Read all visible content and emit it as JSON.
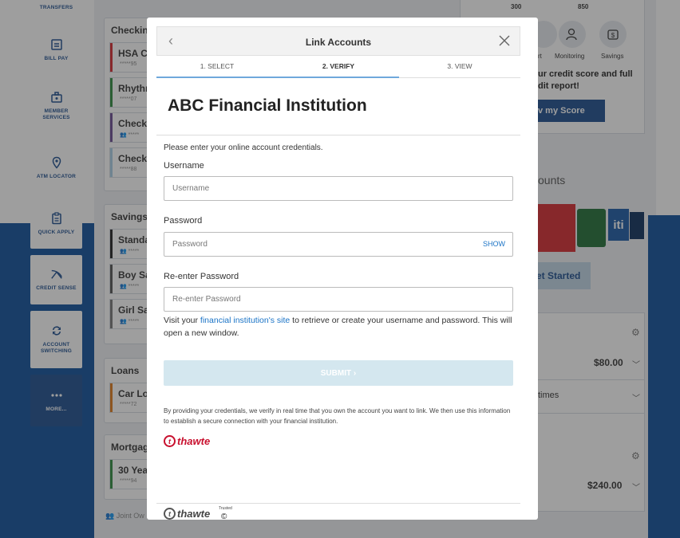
{
  "nav": {
    "transfers": "TRANSFERS",
    "bill_pay": "BILL PAY",
    "member_services": "MEMBER SERVICES",
    "atm_locator": "ATM LOCATOR",
    "quick_apply": "QUICK APPLY",
    "credit_sense": "CREDIT SENSE",
    "account_switching": "ACCOUNT SWITCHING",
    "more": "MORE..."
  },
  "accounts": {
    "checking_header": "Checkin",
    "checking_items": [
      {
        "name": "HSA C",
        "sub": "*****95",
        "color": "#d6282f"
      },
      {
        "name": "Rhythr",
        "sub": "*****07",
        "color": "#2e8b3e"
      },
      {
        "name": "Checki",
        "sub": "👥 *****",
        "color": "#6a4c93"
      },
      {
        "name": "Checki",
        "sub": "*****88",
        "color": "#a9cfe8"
      }
    ],
    "savings_header": "Savings",
    "savings_items": [
      {
        "name": "Standa",
        "sub": "👥 *****",
        "color": "#222222"
      },
      {
        "name": "Boy Sa",
        "sub": "👥 *****",
        "color": "#555555"
      },
      {
        "name": "Girl Sa",
        "sub": "👥 *****",
        "color": "#777777"
      }
    ],
    "loans_header": "Loans",
    "loans_items": [
      {
        "name": "Car Lo",
        "sub": "*****72",
        "color": "#e07b1a"
      }
    ],
    "mortgage_header": "Mortgag",
    "mortgage_items": [
      {
        "name": "30 Yea",
        "sub": "*****94",
        "color": "#2e8b3e"
      }
    ],
    "joint_label": "Joint Ow"
  },
  "credit": {
    "scale_low": "300",
    "scale_high": "850",
    "icon_labels": [
      "rt",
      "Monitoring",
      "Savings"
    ],
    "text": "ur credit score and full dit report!",
    "button": "v my Score"
  },
  "link_panel": {
    "title": "ounts",
    "logo_text": "iti",
    "button": "et Started"
  },
  "bills": {
    "amount1": "$80.00",
    "times": "times",
    "amount2": "$240.00"
  },
  "modal": {
    "title": "Link Accounts",
    "steps": [
      "1. SELECT",
      "2. VERIFY",
      "3. VIEW"
    ],
    "institution": "ABC Financial Institution",
    "prompt": "Please enter your online account credentials.",
    "username_label": "Username",
    "username_placeholder": "Username",
    "password_label": "Password",
    "password_placeholder": "Password",
    "show_label": "SHOW",
    "reenter_label": "Re-enter Password",
    "reenter_placeholder": "Re-enter Password",
    "visit_prefix": "Visit your ",
    "visit_link": "financial institution's site",
    "visit_suffix": " to retrieve or create your username and password. This will open a new window.",
    "submit_label": "SUBMIT",
    "disclaimer": "By providing your credentials, we verify in real time that you own the account you want to link. We then use this information to establish a secure connection with your financial institution.",
    "thawte_word": "thawte",
    "trust_text": "Trusted"
  }
}
